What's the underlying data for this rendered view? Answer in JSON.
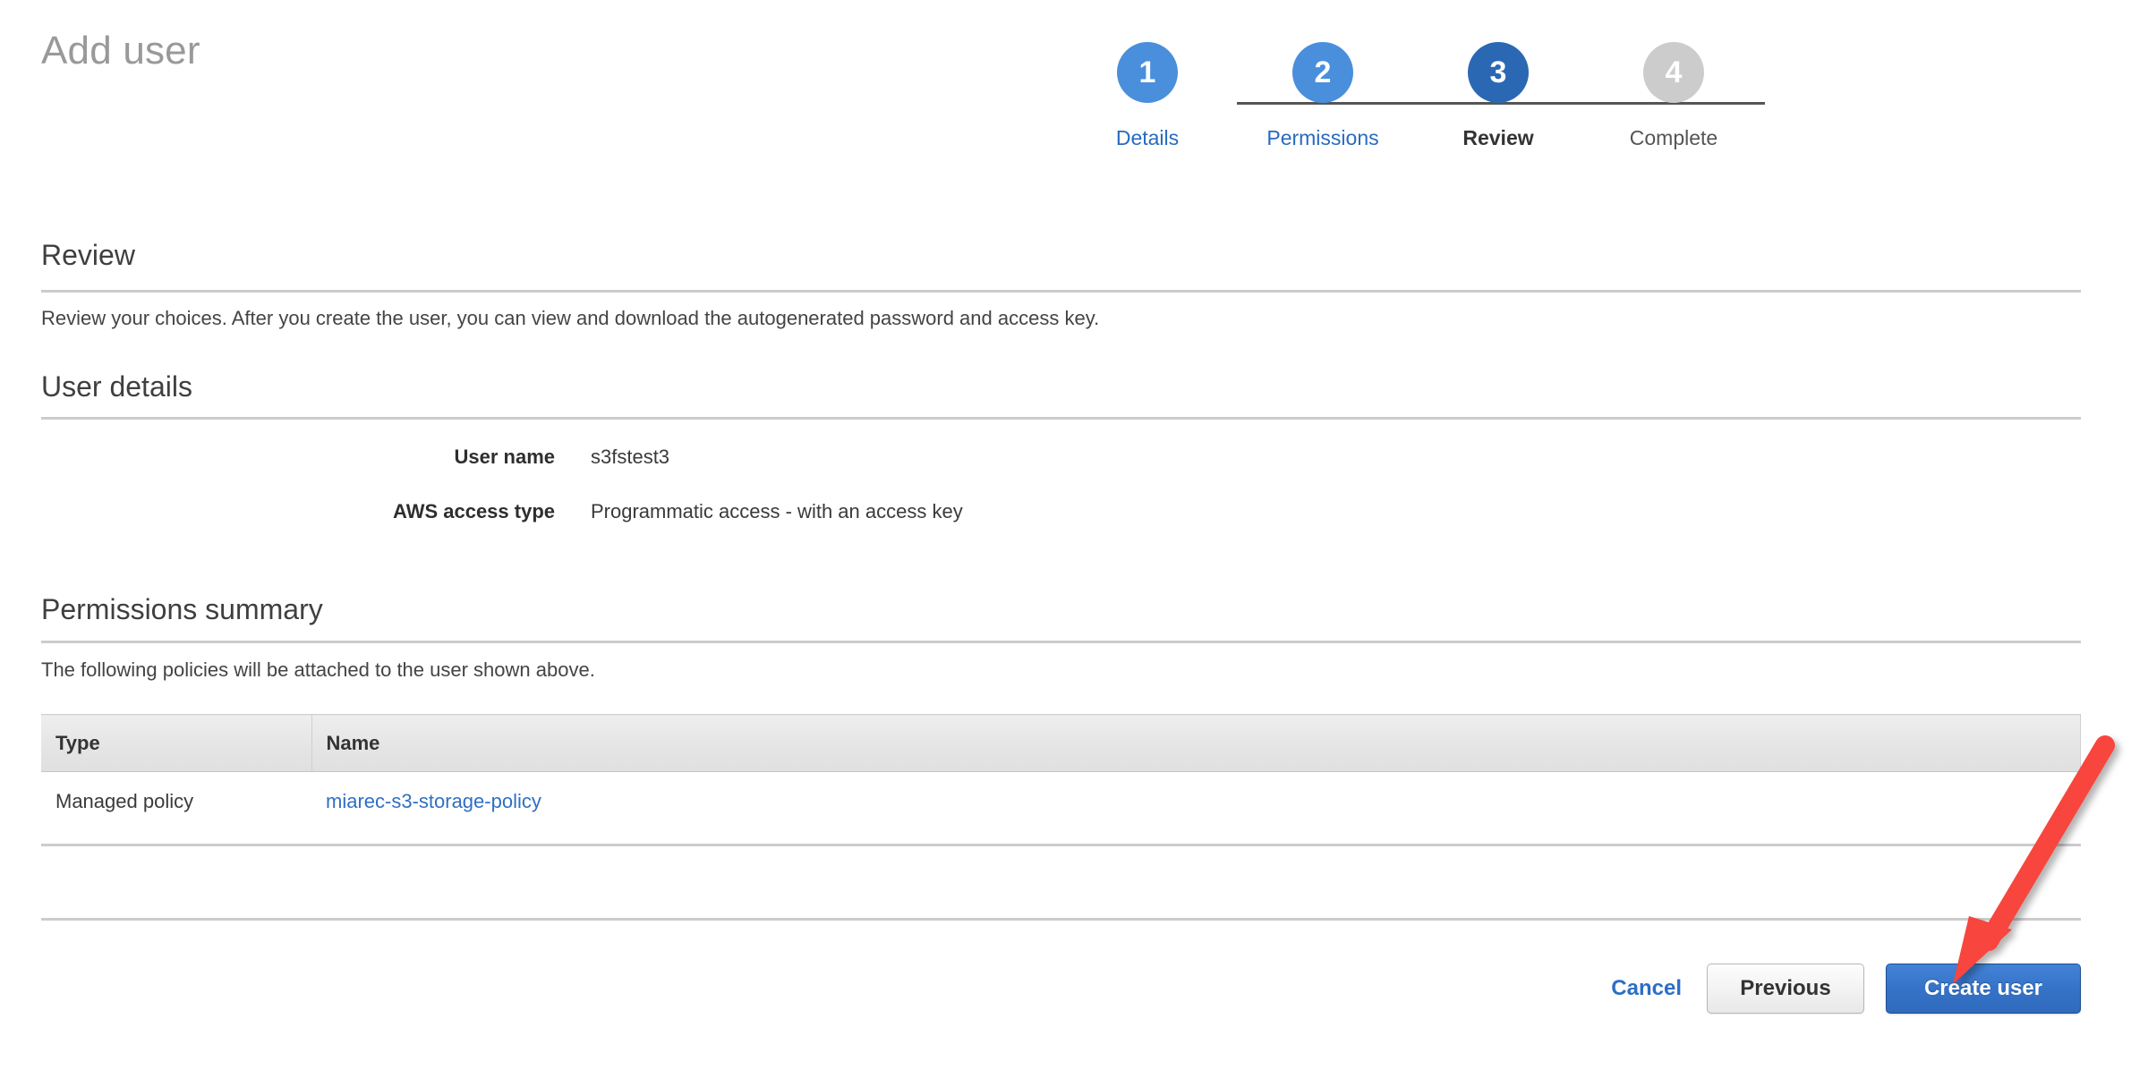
{
  "header": {
    "title": "Add user"
  },
  "stepper": {
    "steps": [
      {
        "number": "1",
        "label": "Details",
        "state": "done"
      },
      {
        "number": "2",
        "label": "Permissions",
        "state": "done"
      },
      {
        "number": "3",
        "label": "Review",
        "state": "current"
      },
      {
        "number": "4",
        "label": "Complete",
        "state": "todo"
      }
    ],
    "colors": {
      "done": "#4a8fdb",
      "current": "#2b68b4",
      "todo": "#cccccc",
      "connector": "#565656",
      "link_text": "#276bbf"
    }
  },
  "review": {
    "heading": "Review",
    "description": "Review your choices. After you create the user, you can view and download the autogenerated password and access key."
  },
  "user_details": {
    "heading": "User details",
    "rows": [
      {
        "label": "User name",
        "value": "s3fstest3"
      },
      {
        "label": "AWS access type",
        "value": "Programmatic access - with an access key"
      }
    ]
  },
  "permissions_summary": {
    "heading": "Permissions summary",
    "description": "The following policies will be attached to the user shown above.",
    "table": {
      "columns": [
        "Type",
        "Name"
      ],
      "rows": [
        {
          "type": "Managed policy",
          "name": "miarec-s3-storage-policy",
          "name_is_link": true
        }
      ]
    }
  },
  "footer": {
    "cancel_label": "Cancel",
    "previous_label": "Previous",
    "create_user_label": "Create user",
    "primary_color": "#3573c8",
    "link_color": "#2b6fc6"
  },
  "annotation": {
    "type": "arrow",
    "color": "#f8443e",
    "points_to": "create-user-button"
  }
}
